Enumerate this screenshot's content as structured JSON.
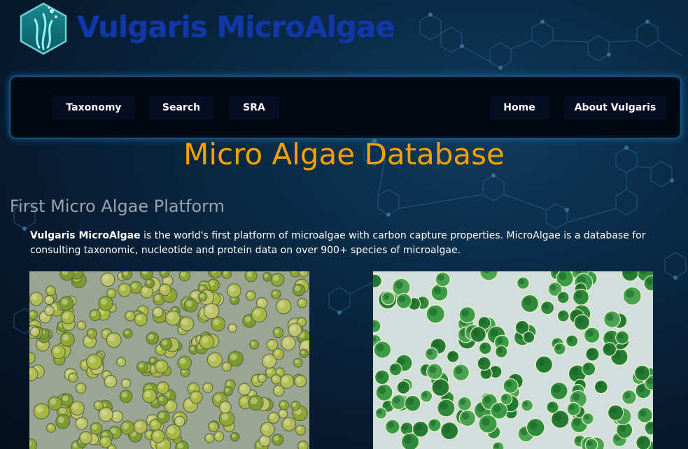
{
  "header": {
    "site_title": "Vulgaris MicroAlgae",
    "logo_icon": "seaweed-hexagon-logo",
    "title_color": "#1238a8"
  },
  "nav": {
    "left": [
      "Taxonomy",
      "Search",
      "SRA"
    ],
    "right": [
      "Home",
      "About Vulgaris"
    ]
  },
  "main": {
    "title": "Micro Algae Database",
    "title_color": "#f5a100",
    "subtitle": "First Micro Algae Platform",
    "intro_bold": "Vulgaris MicroAlgae",
    "intro_text": " is the world's first platform of microalgae with carbon capture properties. MicroAlgae is a database for consulting taxonomic, nucleotide and protein data on over 900+ species of microalgae.",
    "images": [
      "microalgae-microscopy-photo",
      "green-algae-cells-photo"
    ]
  }
}
